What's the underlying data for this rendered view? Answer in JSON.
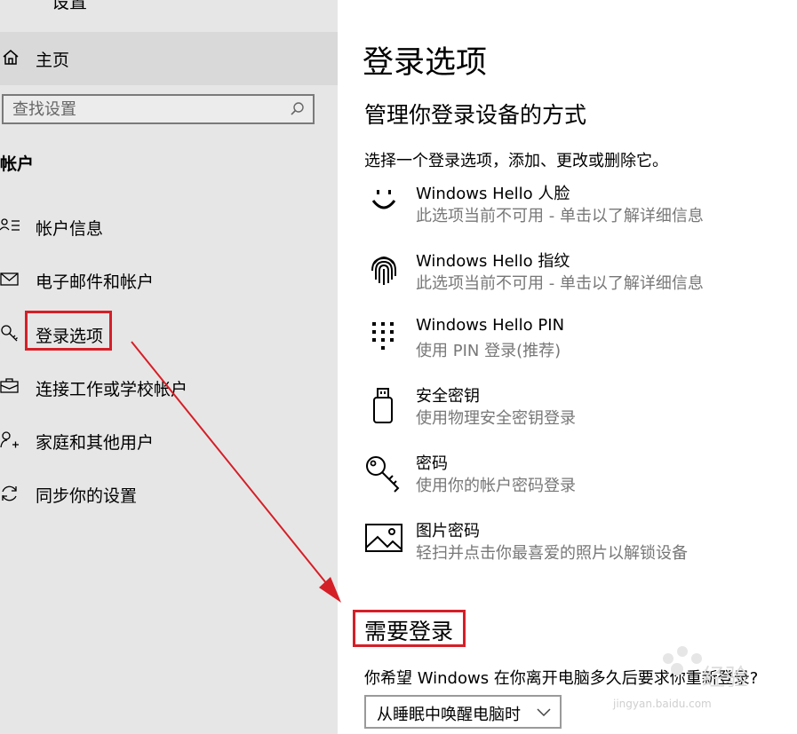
{
  "sidebar": {
    "top_cut": "设置",
    "home_label": "主页",
    "search_placeholder": "查找设置",
    "section_title": "帐户",
    "items": [
      {
        "label": "帐户信息",
        "icon": "account-info-icon"
      },
      {
        "label": "电子邮件和帐户",
        "icon": "mail-icon"
      },
      {
        "label": "登录选项",
        "icon": "key-icon"
      },
      {
        "label": "连接工作或学校帐户",
        "icon": "briefcase-icon"
      },
      {
        "label": "家庭和其他用户",
        "icon": "add-person-icon"
      },
      {
        "label": "同步你的设置",
        "icon": "sync-icon"
      }
    ]
  },
  "main": {
    "title": "登录选项",
    "subtitle": "管理你登录设备的方式",
    "description": "选择一个登录选项，添加、更改或删除它。",
    "options": [
      {
        "title": "Windows Hello 人脸",
        "subtitle": "此选项当前不可用 - 单击以了解详细信息",
        "icon": "face-icon"
      },
      {
        "title": "Windows Hello 指纹",
        "subtitle": "此选项当前不可用 - 单击以了解详细信息",
        "icon": "fingerprint-icon"
      },
      {
        "title": "Windows Hello PIN",
        "subtitle": "使用 PIN 登录(推荐)",
        "icon": "pin-keypad-icon"
      },
      {
        "title": "安全密钥",
        "subtitle": "使用物理安全密钥登录",
        "icon": "usb-key-icon"
      },
      {
        "title": "密码",
        "subtitle": "使用你的帐户密码登录",
        "icon": "key-icon"
      },
      {
        "title": "图片密码",
        "subtitle": "轻扫并点击你最喜爱的照片以解锁设备",
        "icon": "picture-icon"
      }
    ],
    "require_title": "需要登录",
    "question": "你希望 Windows 在你离开电脑多久后要求你重新登录?",
    "dropdown_value": "从睡眠中唤醒电脑时"
  },
  "annotation": {
    "color": "#d51f27"
  },
  "watermark": {
    "text": "jingyan.baidu.com",
    "logo": "Baidu-logo"
  },
  "colors": {
    "sidebar_bg": "#e6e6e6",
    "home_bg": "#d9d9d9",
    "secondary_text": "#777777"
  }
}
